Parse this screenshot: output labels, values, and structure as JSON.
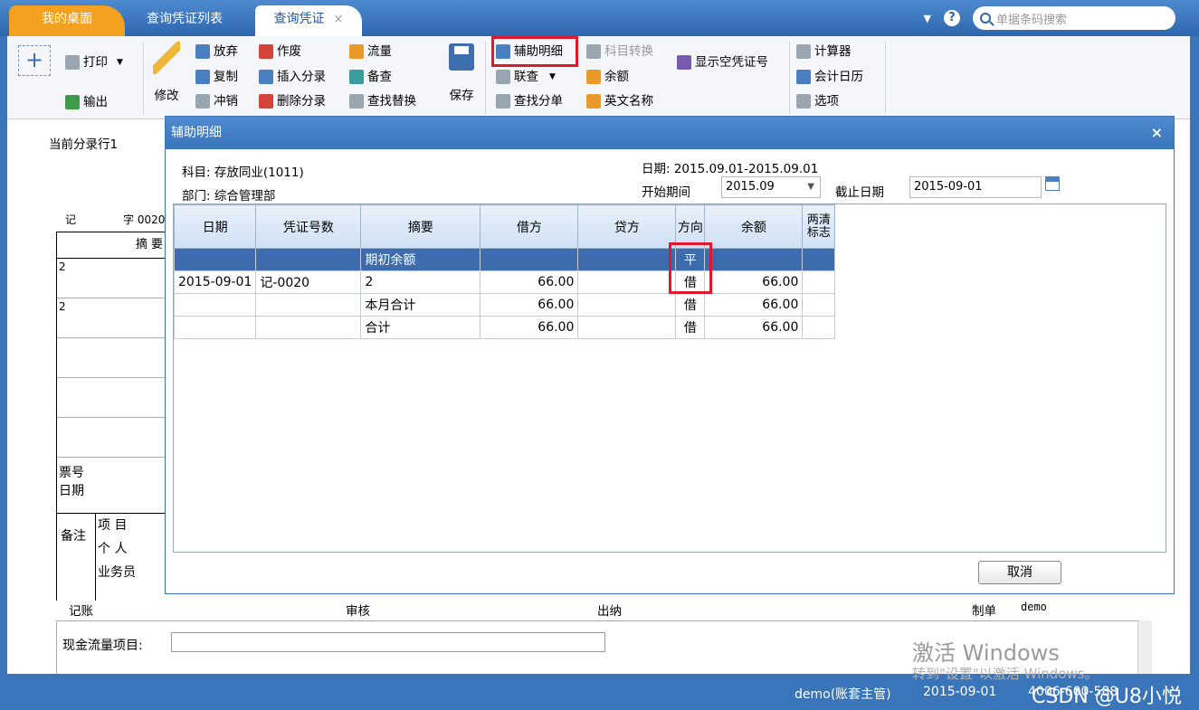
{
  "tabs": {
    "home": "我的桌面",
    "list": "查询凭证列表",
    "active": "查询凭证",
    "close": "×"
  },
  "search": {
    "placeholder": "单据条码搜索"
  },
  "toolbar": {
    "print": "打印",
    "export": "输出",
    "modify": "修改",
    "abandon": "放弃",
    "copy": "复制",
    "reverse": "冲销",
    "void": "作废",
    "insert_entry": "插入分录",
    "delete_entry": "删除分录",
    "flow": "流量",
    "check": "备查",
    "find_replace": "查找替换",
    "save": "保存",
    "aux_detail": "辅助明细",
    "link_query": "联查",
    "find_entry": "查找分单",
    "account_convert": "科目转换",
    "balance": "余额",
    "english_name": "英文名称",
    "show_empty_no": "显示空凭证号",
    "calculator": "计算器",
    "calendar": "会计日历",
    "options": "选项"
  },
  "voucher": {
    "current_row": "当前分录行1",
    "type": "记",
    "zi": "字 0020",
    "summary_header": "摘 要",
    "rows": [
      "2",
      "2",
      "",
      "",
      ""
    ],
    "ticket_no": "票号",
    "ticket_date": "日期",
    "remark": "备注",
    "project": "项 目",
    "person": "个 人",
    "salesman": "业务员",
    "post": "记账",
    "audit": "审核",
    "cashier": "出纳",
    "maker_label": "制单",
    "maker": "demo",
    "cash_flow": "现金流量项目:"
  },
  "dialog": {
    "title": "辅助明细",
    "close": "×",
    "subject": "科目: 存放同业(1011)",
    "department": "部门: 综合管理部",
    "date_range": "日期: 2015.09.01-2015.09.01",
    "start_period_label": "开始期间",
    "start_period": "2015.09",
    "end_date_label": "截止日期",
    "end_date": "2015-09-01",
    "cancel": "取消",
    "columns": [
      "日期",
      "凭证号数",
      "摘要",
      "借方",
      "贷方",
      "方向",
      "余额",
      "两清标志"
    ],
    "rows": [
      {
        "date": "",
        "voucher": "",
        "summary": "期初余额",
        "debit": "",
        "credit": "",
        "dir": "平",
        "balance": "",
        "flag": ""
      },
      {
        "date": "2015-09-01",
        "voucher": "记-0020",
        "summary": "2",
        "debit": "66.00",
        "credit": "",
        "dir": "借",
        "balance": "66.00",
        "flag": ""
      },
      {
        "date": "",
        "voucher": "",
        "summary": "本月合计",
        "debit": "66.00",
        "credit": "",
        "dir": "借",
        "balance": "66.00",
        "flag": ""
      },
      {
        "date": "",
        "voucher": "",
        "summary": "合计",
        "debit": "66.00",
        "credit": "",
        "dir": "借",
        "balance": "66.00",
        "flag": ""
      }
    ]
  },
  "status": {
    "user": "demo(账套主管)",
    "date": "2015-09-01",
    "phone": "4006-600-588",
    "watermark": "激活 Windows",
    "watermark_sub": "转到\"设置\"以激活 Windows。",
    "csdn": "CSDN @U8小悦"
  }
}
